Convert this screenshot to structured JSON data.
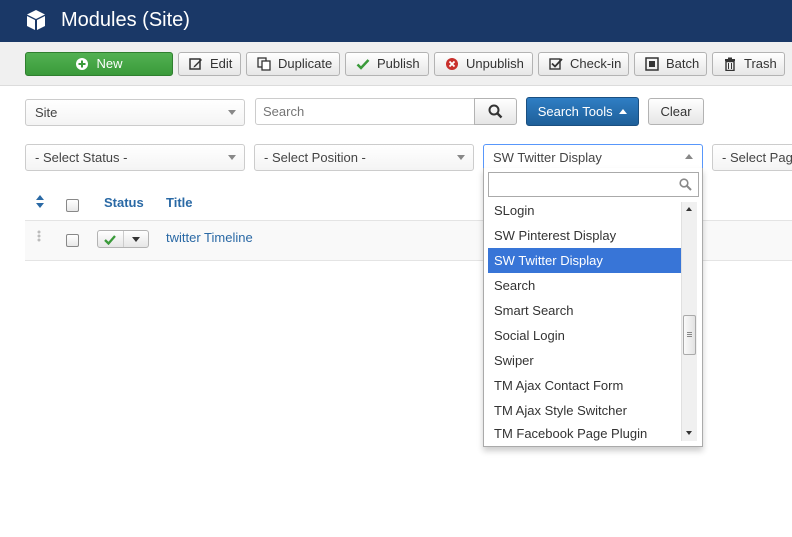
{
  "header": {
    "title": "Modules (Site)",
    "icon": "cube-icon"
  },
  "toolbar": {
    "new": "New",
    "edit": "Edit",
    "duplicate": "Duplicate",
    "publish": "Publish",
    "unpublish": "Unpublish",
    "checkin": "Check-in",
    "batch": "Batch",
    "trash": "Trash"
  },
  "filters": {
    "client": "Site",
    "search_placeholder": "Search",
    "search_tools": "Search Tools",
    "clear": "Clear",
    "status": "- Select Status -",
    "position": "- Select Position -",
    "module": "SW Twitter Display",
    "pages": "- Select Pag"
  },
  "table": {
    "headers": {
      "status": "Status",
      "title": "Title"
    },
    "rows": [
      {
        "title": "twitter Timeline",
        "published": true
      }
    ]
  },
  "dropdown": {
    "items": [
      "SLogin",
      "SW Pinterest Display",
      "SW Twitter Display",
      "Search",
      "Smart Search",
      "Social Login",
      "Swiper",
      "TM Ajax Contact Form",
      "TM Ajax Style Switcher",
      "TM Facebook Page Plugin"
    ],
    "selected": "SW Twitter Display"
  },
  "colors": {
    "header": "#1a3867",
    "accent_blue": "#3875d7",
    "new_green": "#3a9a3a",
    "link": "#2a69a5"
  }
}
